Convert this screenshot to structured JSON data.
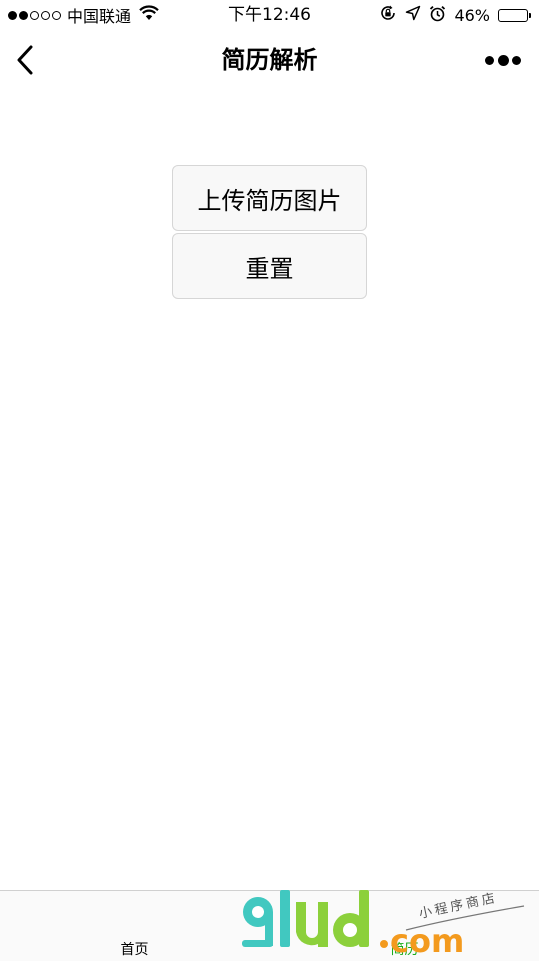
{
  "status_bar": {
    "carrier": "中国联通",
    "time": "下午12:46",
    "battery_percent": "46%",
    "battery_level": 0.46,
    "signal_bars_filled": 2,
    "signal_bars_total": 5
  },
  "nav": {
    "title": "简历解析"
  },
  "main": {
    "upload_button_label": "上传简历图片",
    "reset_button_label": "重置"
  },
  "tabs": [
    {
      "label": "首页",
      "active": false
    },
    {
      "label": "简历",
      "active": true
    }
  ],
  "watermark": {
    "logo_text": "91ud.com",
    "tagline": "小程序商店"
  },
  "colors": {
    "active_tab": "#1aad19",
    "battery_fill": "#f2c400",
    "watermark_teal": "#41c8c0",
    "watermark_green": "#8cd03b",
    "watermark_orange": "#f39a1e"
  },
  "icons": [
    "signal-icon",
    "wifi-icon",
    "orientation-lock-icon",
    "location-arrow-icon",
    "alarm-icon",
    "battery-icon",
    "back-chevron-icon",
    "more-dots-icon"
  ]
}
